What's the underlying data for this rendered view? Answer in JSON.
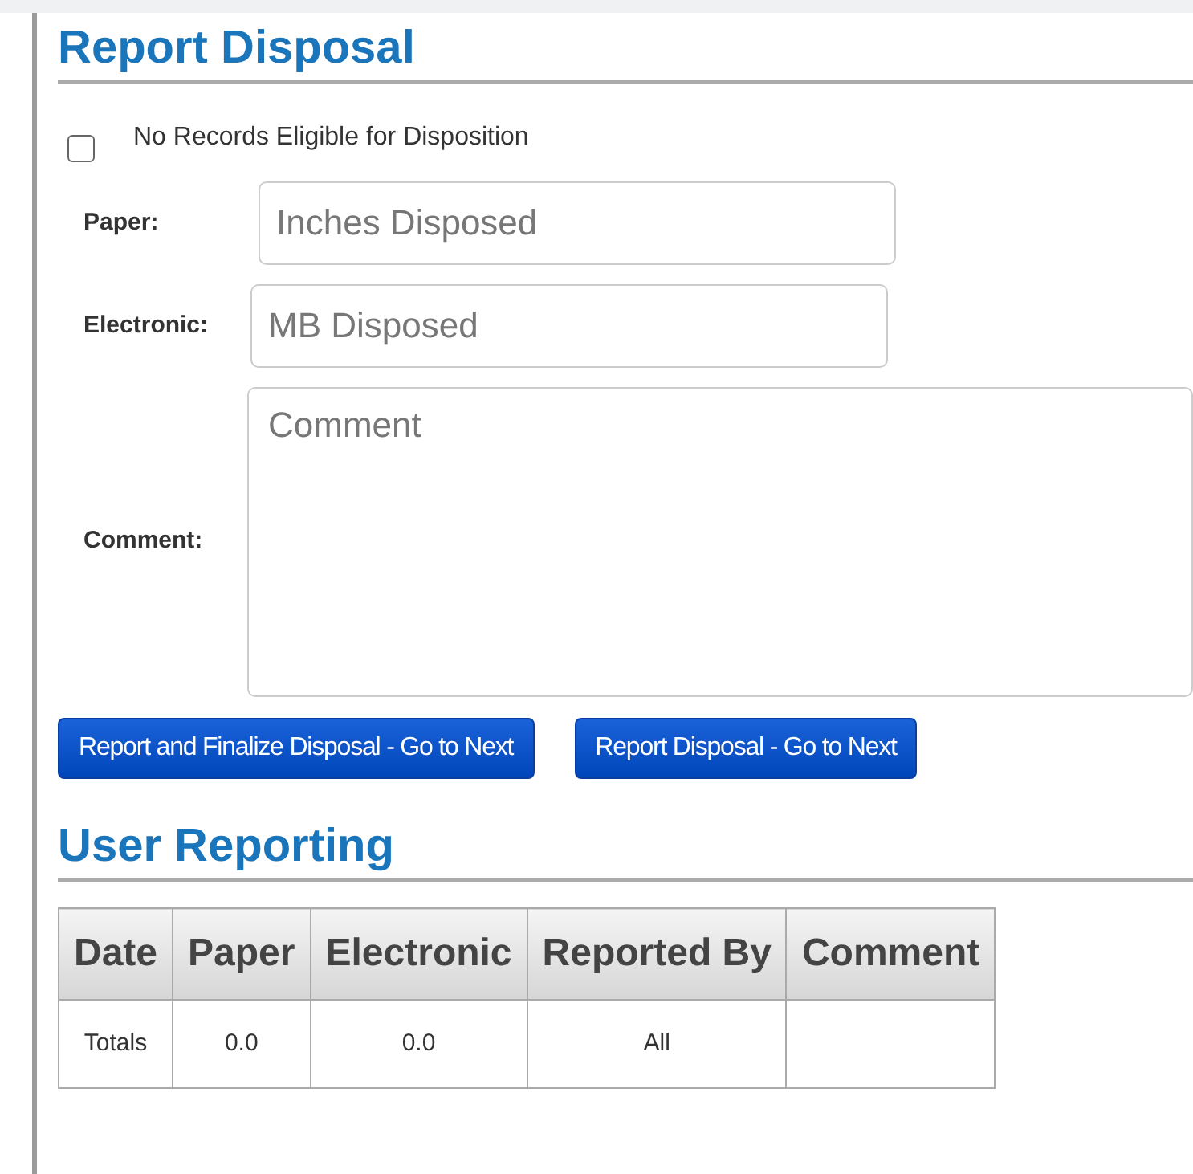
{
  "report_disposal": {
    "title": "Report Disposal",
    "no_records": {
      "label": "No Records Eligible for Disposition",
      "checked": false
    },
    "fields": [
      {
        "kind": "input",
        "label": "Paper:",
        "placeholder": "Inches Disposed"
      },
      {
        "kind": "input",
        "label": "Electronic:",
        "placeholder": "MB Disposed"
      },
      {
        "kind": "textarea",
        "label": "Comment:",
        "placeholder": "Comment"
      }
    ],
    "buttons": [
      "Report and Finalize Disposal - Go to Next",
      "Report Disposal - Go to Next"
    ]
  },
  "user_reporting": {
    "title": "User Reporting",
    "table": {
      "columns": [
        "Date",
        "Paper",
        "Electronic",
        "Reported By",
        "Comment"
      ],
      "rows": [
        [
          "Totals",
          "0.0",
          "0.0",
          "All",
          ""
        ]
      ]
    }
  }
}
